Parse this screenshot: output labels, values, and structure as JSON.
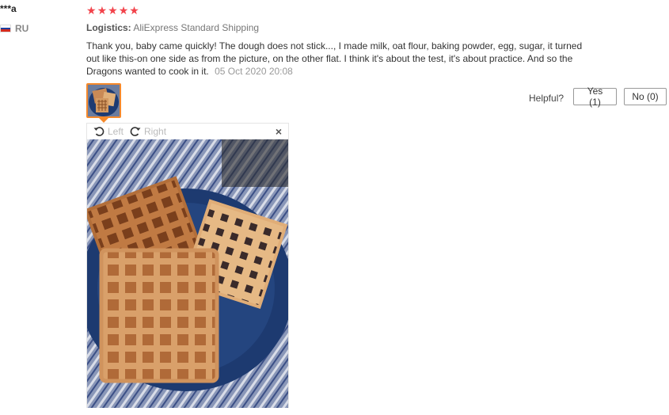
{
  "review": {
    "reviewer_name": "***a",
    "country_code": "RU",
    "rating": 5,
    "stars": [
      "★",
      "★",
      "★",
      "★",
      "★"
    ],
    "logistics_label": "Logistics:",
    "logistics_value": "AliExpress Standard Shipping",
    "feedback_text": "Thank you, baby came quickly! The dough does not stick..., I made milk, oat flour, baking powder, egg, sugar, it turned out like this-on one side as from the picture, on the other flat. I think it's about the test, it's about practice. And so the Dragons wanted to cook in it.",
    "date": "05 Oct 2020 20:08"
  },
  "helpful": {
    "label": "Helpful?",
    "yes_label": "Yes (1)",
    "no_label": "No (0)"
  },
  "viewer": {
    "rotate_left_label": "Left",
    "rotate_right_label": "Right",
    "close_glyph": "×"
  },
  "icons": {
    "flag": "russia-flag-icon",
    "rotate_left": "rotate-left-icon",
    "rotate_right": "rotate-right-icon",
    "close": "close-icon",
    "star": "star-icon"
  },
  "colors": {
    "star": "#f2434b",
    "thumb_border": "#f5892b",
    "flag": [
      "#ffffff",
      "#1c3f9e",
      "#d52b1e"
    ]
  }
}
